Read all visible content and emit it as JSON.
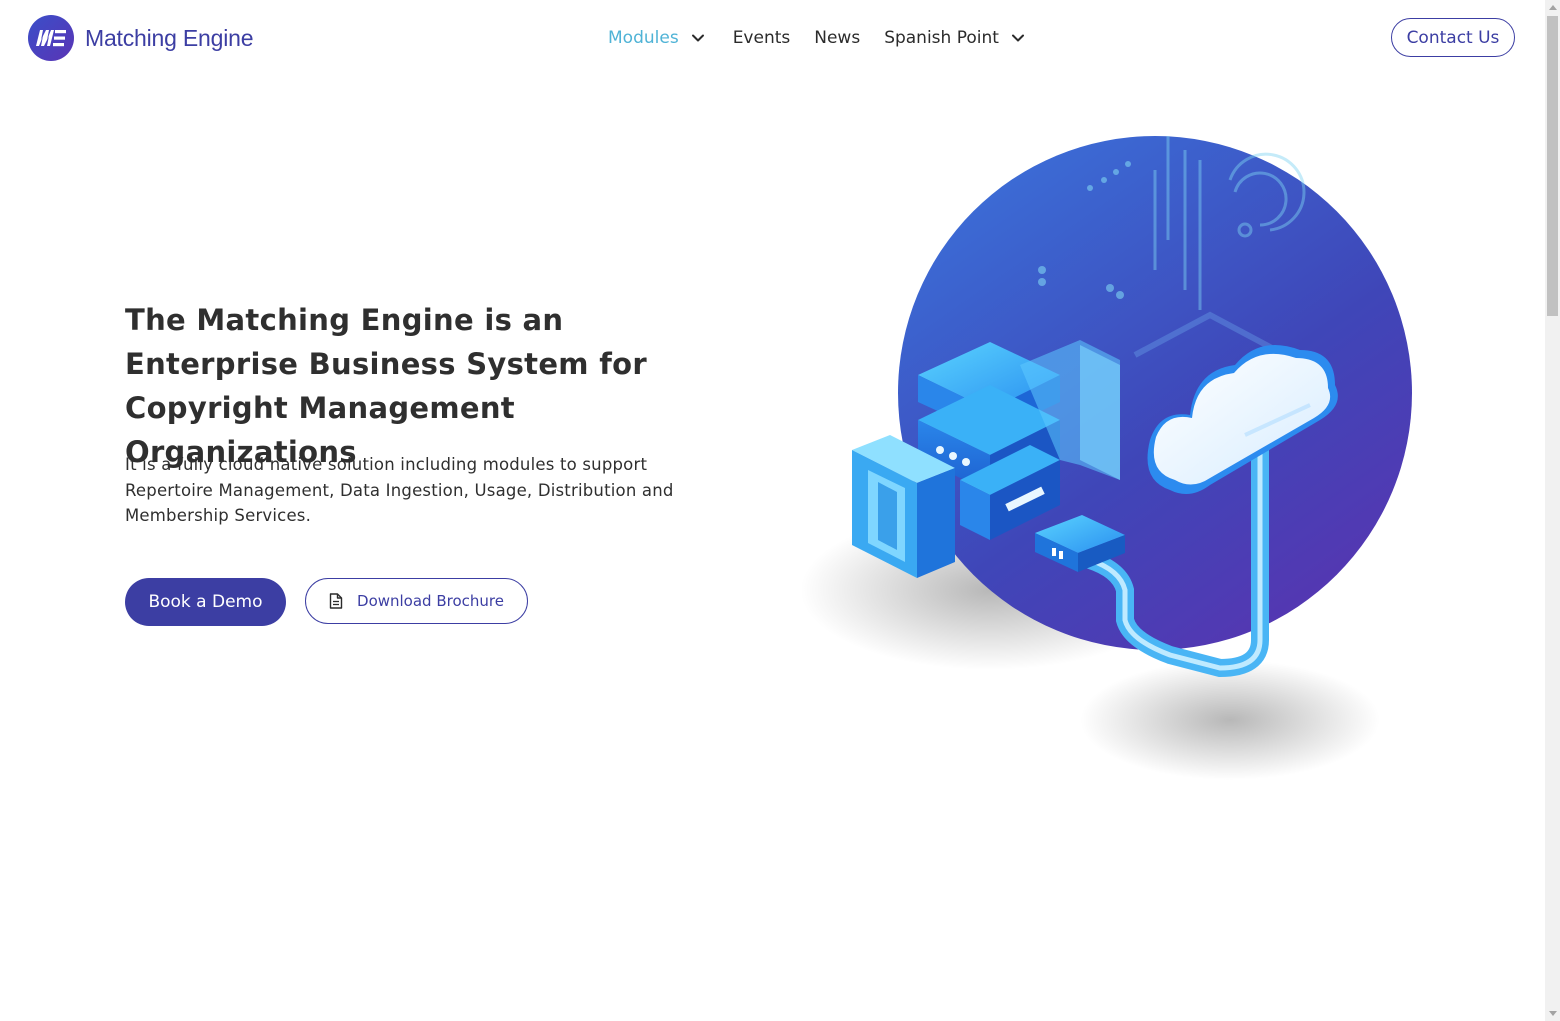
{
  "brand": {
    "name": "Matching Engine",
    "logo_icon": "me-monogram-icon",
    "accent_color": "#3c3ea3",
    "highlight_color": "#4fb3d6"
  },
  "nav": {
    "items": [
      {
        "label": "Modules",
        "has_dropdown": true,
        "active": true
      },
      {
        "label": "Events",
        "has_dropdown": false,
        "active": false
      },
      {
        "label": "News",
        "has_dropdown": false,
        "active": false
      },
      {
        "label": "Spanish Point",
        "has_dropdown": true,
        "active": false
      }
    ],
    "contact_label": "Contact Us"
  },
  "hero": {
    "title": "The Matching Engine is an Enterprise Business System for Copyright Management Organizations",
    "subtitle": "It is a fully cloud native solution including modules to support Repertoire Management, Data Ingestion, Usage, Distribution and Membership Services.",
    "primary_button": "Book a Demo",
    "secondary_button": "Download Brochure",
    "secondary_icon": "document-icon",
    "illustration": "cloud-servers-illustration"
  }
}
